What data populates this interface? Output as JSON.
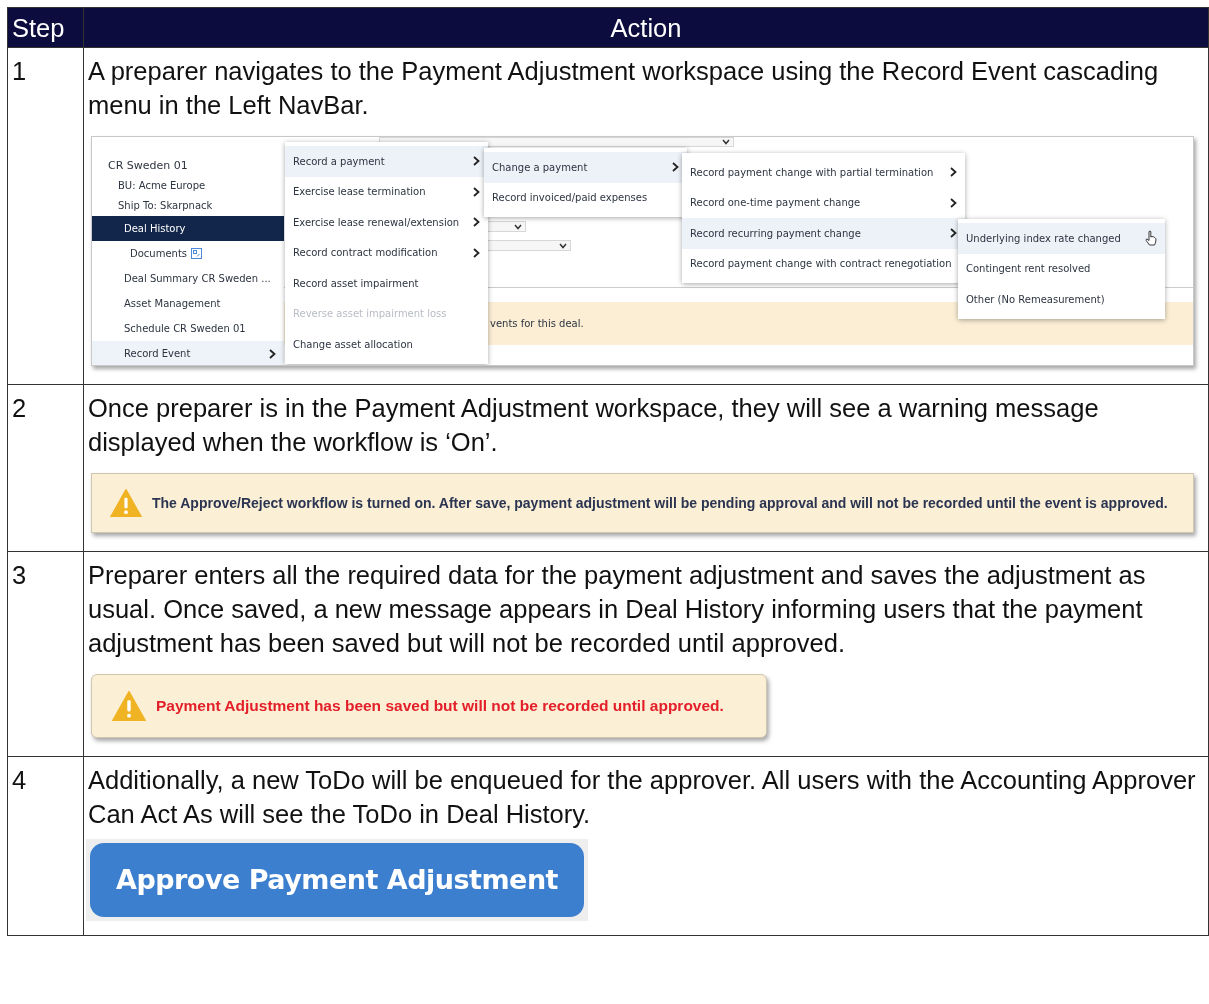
{
  "table": {
    "columns": [
      "Step",
      "Action"
    ],
    "rows": [
      {
        "step": "1",
        "action": "A preparer navigates to the Payment Adjustment workspace using the Record Event cascading menu in the Left NavBar.",
        "figure": {
          "kind": "cascading_menu",
          "sidebar": {
            "title": "CR Sweden 01",
            "details": [
              "BU: Acme Europe",
              "Ship To: Skarpnack"
            ],
            "items": [
              {
                "label": "Deal History",
                "kind": "nav",
                "selected": true,
                "expanded": false
              },
              {
                "label": "Documents",
                "kind": "nav_external",
                "selected": false,
                "expanded": false
              },
              {
                "label": "Deal Summary CR Sweden ...",
                "kind": "nav",
                "selected": false,
                "expanded": false
              },
              {
                "label": "Asset Management",
                "kind": "nav",
                "selected": false,
                "expanded": false
              },
              {
                "label": "Schedule CR Sweden 01",
                "kind": "nav",
                "selected": false,
                "expanded": false
              },
              {
                "label": "Record Event",
                "kind": "nav_menu",
                "selected": false,
                "expanded": true
              }
            ]
          },
          "background_banner": "vents for this deal.",
          "menus": [
            {
              "items": [
                {
                  "label": "Record a payment",
                  "selected": true,
                  "submenu": true,
                  "disabled": false
                },
                {
                  "label": "Exercise lease termination",
                  "selected": false,
                  "submenu": true,
                  "disabled": false
                },
                {
                  "label": "Exercise lease renewal/extension",
                  "selected": false,
                  "submenu": true,
                  "disabled": false
                },
                {
                  "label": "Record contract modification",
                  "selected": false,
                  "submenu": true,
                  "disabled": false
                },
                {
                  "label": "Record asset impairment",
                  "selected": false,
                  "submenu": false,
                  "disabled": false
                },
                {
                  "label": "Reverse asset impairment loss",
                  "selected": false,
                  "submenu": false,
                  "disabled": true
                },
                {
                  "label": "Change asset allocation",
                  "selected": false,
                  "submenu": false,
                  "disabled": false
                }
              ]
            },
            {
              "items": [
                {
                  "label": "Change a payment",
                  "selected": true,
                  "submenu": true
                },
                {
                  "label": "Record invoiced/paid expenses",
                  "selected": false,
                  "submenu": false
                }
              ]
            },
            {
              "items": [
                {
                  "label": "Record payment change with partial termination",
                  "selected": false,
                  "submenu": true
                },
                {
                  "label": "Record one-time payment change",
                  "selected": false,
                  "submenu": true
                },
                {
                  "label": "Record recurring payment change",
                  "selected": true,
                  "submenu": true
                },
                {
                  "label": "Record payment change with contract renegotiation",
                  "selected": false,
                  "submenu": false
                }
              ]
            },
            {
              "items": [
                {
                  "label": "Underlying index rate changed",
                  "selected": true,
                  "submenu": false,
                  "cursor": true
                },
                {
                  "label": "Contingent rent resolved",
                  "selected": false,
                  "submenu": false,
                  "cursor": false
                },
                {
                  "label": "Other (No Remeasurement)",
                  "selected": false,
                  "submenu": false,
                  "cursor": false
                }
              ]
            }
          ]
        }
      },
      {
        "step": "2",
        "action": "Once preparer is in the Payment Adjustment workspace, they will see a warning message displayed when the workflow is ‘On’.",
        "figure": {
          "kind": "notice_banner",
          "text": "The Approve/Reject workflow is turned on. After save, payment adjustment will be pending approval and will not be recorded until the event is approved."
        }
      },
      {
        "step": "3",
        "action": "Preparer enters all the required data for the payment adjustment and saves the adjustment as usual. Once saved, a new message appears in Deal History informing users that the payment adjustment has been saved but will not be recorded until approved.",
        "figure": {
          "kind": "alert_banner",
          "text": "Payment Adjustment has been saved but will not be recorded until approved."
        }
      },
      {
        "step": "4",
        "action": "Additionally, a new ToDo will be enqueued for the approver. All users with the Accounting Approver Can Act As will see the ToDo in Deal History.",
        "figure": {
          "kind": "button",
          "label": "Approve Payment Adjustment"
        }
      }
    ]
  }
}
